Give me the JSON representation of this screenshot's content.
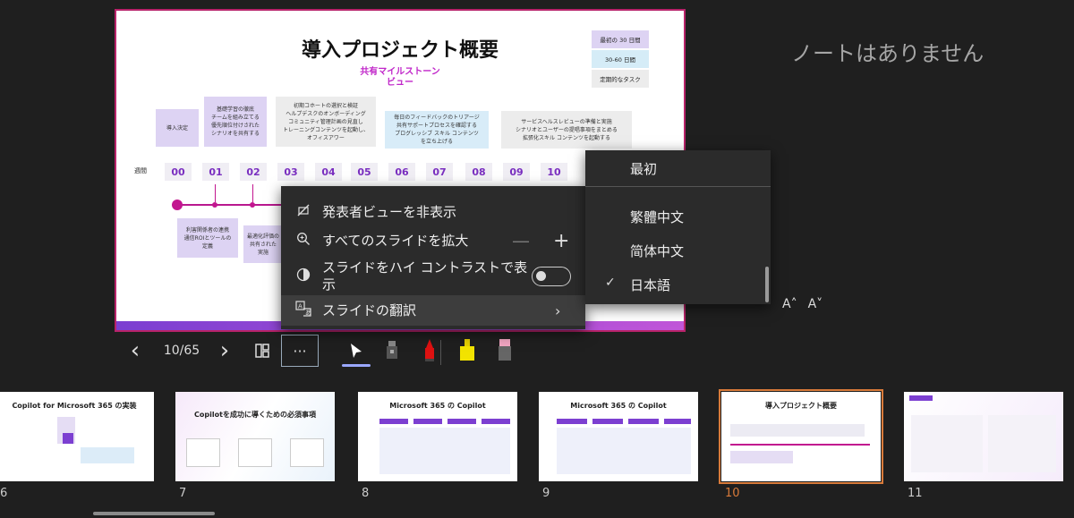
{
  "slide": {
    "title": "導入プロジェクト概要",
    "subtitle": "共有マイルストーン\nビュー",
    "legend": [
      "最初の 30 日間",
      "30-60 日間",
      "定期的なタスク"
    ],
    "top_boxes": [
      "導入決定",
      "基礎学習の徹底\nチームを組み立てる\n優先順位付けされた\nシナリオを共有する",
      "初期コホートの選択と検証\nヘルプデスクのオンボーディング\nコミュニティ管理計画の見直し\nトレーニングコンテンツを起動し、\nオフィスアワー",
      "毎日のフィードバックのトリアージ\n共有サポートプロセスを確認する\nプログレッシブ スキル コンテンツ\nを立ち上げる",
      "サービスヘルスレビューの準備と実施\nシナリオとユーザーの提唱事項をまとめる\n拡張化スキル コンテンツを起動する"
    ],
    "bottom_boxes": [
      "利害関係者の連携\n通信ROIとツールの\n定義",
      "最適化評価の\n共有された\n実施"
    ],
    "week_label": "週間",
    "weeks": [
      "00",
      "01",
      "02",
      "03",
      "04",
      "05",
      "06",
      "07",
      "08",
      "09",
      "10"
    ]
  },
  "notes": {
    "empty_text": "ノートはありません",
    "font_up": "A˄",
    "font_down": "A˅"
  },
  "toolbar": {
    "prev": "‹",
    "counter": "10/65",
    "next": "›",
    "more": "···"
  },
  "menu": {
    "items": [
      {
        "label": "発表者ビューを非表示"
      },
      {
        "label": "すべてのスライドを拡大",
        "minus": "—",
        "plus": "+"
      },
      {
        "label": "スライドをハイ コントラストで表\n示"
      },
      {
        "label": "スライドの翻訳",
        "arrow": "›"
      }
    ]
  },
  "submenu": {
    "items": [
      "最初",
      "繁體中文",
      "简体中文",
      "日本語"
    ],
    "check": "✓"
  },
  "thumbnails": [
    {
      "num": "6",
      "title": "Copilot for Microsoft 365 の実装"
    },
    {
      "num": "7",
      "title": "Copilotを成功に導くための必須事項"
    },
    {
      "num": "8",
      "title": "Microsoft 365 の Copilot"
    },
    {
      "num": "9",
      "title": "Microsoft 365 の Copilot"
    },
    {
      "num": "10",
      "title": "導入プロジェクト概要"
    },
    {
      "num": "11",
      "title": ""
    }
  ],
  "colors": {
    "accent": "#d87a3a",
    "slide_border": "#b8236a",
    "timeline": "#c2168f"
  }
}
